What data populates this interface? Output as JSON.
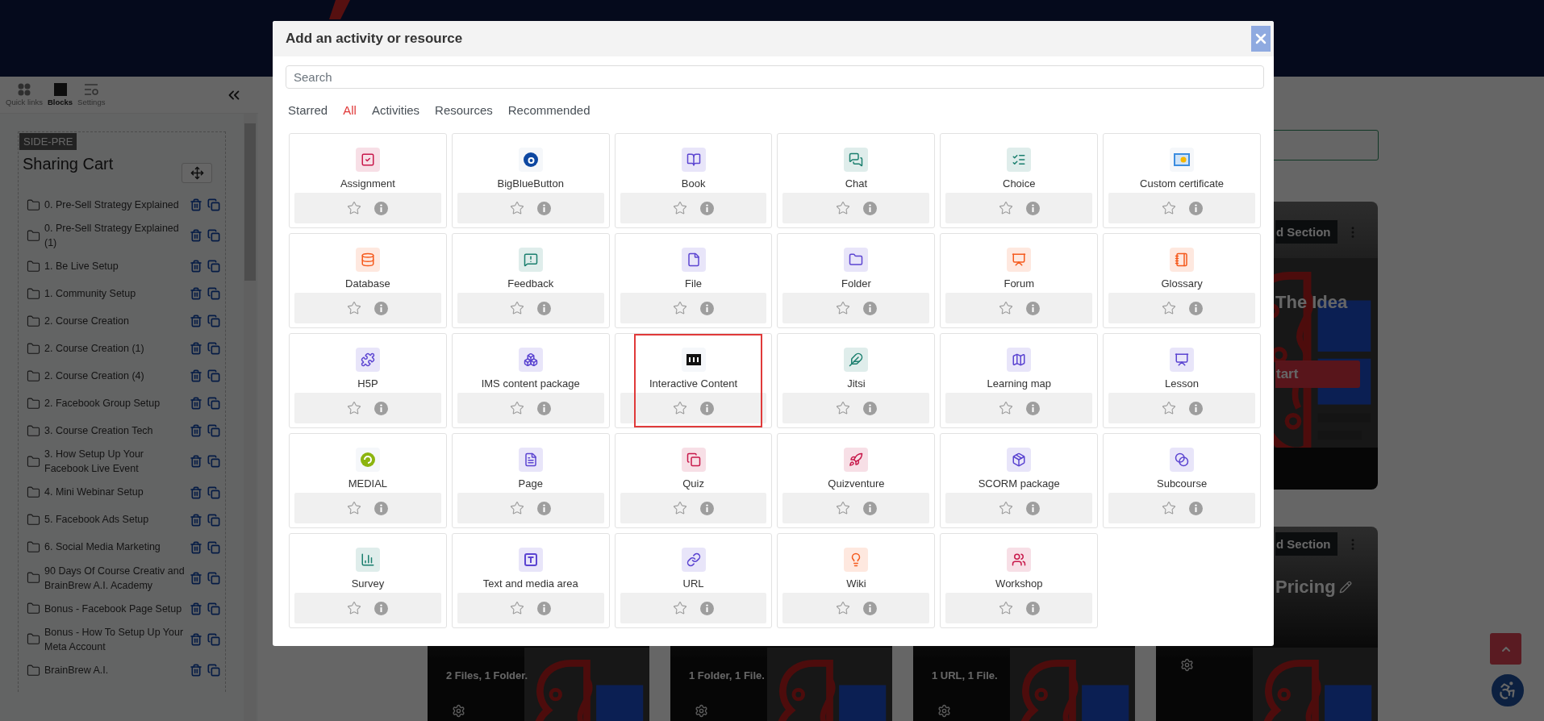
{
  "drawer": {
    "tabs": [
      {
        "label": "Quick links",
        "selected": false
      },
      {
        "label": "Blocks",
        "selected": true
      },
      {
        "label": "Settings",
        "selected": false
      }
    ],
    "block": {
      "region": "SIDE-PRE",
      "title": "Sharing Cart",
      "items": [
        {
          "label": "0. Pre-Sell Strategy Explained"
        },
        {
          "label": "0. Pre-Sell Strategy Explained (1)"
        },
        {
          "label": "1. Be Live Setup"
        },
        {
          "label": "1. Community Setup"
        },
        {
          "label": "2. Course Creation"
        },
        {
          "label": "2. Course Creation (1)"
        },
        {
          "label": "2. Course Creation (4)"
        },
        {
          "label": "2. Facebook Group Setup"
        },
        {
          "label": "3. Course Creation Tech"
        },
        {
          "label": "3. How Setup Up Your Facebook Live Event"
        },
        {
          "label": "4. Mini Webinar Setup"
        },
        {
          "label": "5. Facebook Ads Setup"
        },
        {
          "label": "6. Social Media Marketing"
        },
        {
          "label": "90 Days Of Course Creativ and BrainBrew A.I. Academy"
        },
        {
          "label": "Bonus - Facebook Page Setup"
        },
        {
          "label": "Bonus - How To Setup Up Your Meta Account"
        },
        {
          "label": "BrainBrew A.I."
        }
      ]
    }
  },
  "course": {
    "sections": [
      {
        "cards": [
          {
            "button": "d Section",
            "title": "The Idea",
            "action": "tart"
          }
        ]
      },
      {
        "cards": [
          {
            "summary": "2 Files, 1 Folder."
          },
          {
            "summary": "1 Folder, 1 File."
          },
          {
            "summary": "1 URL, 1 File."
          },
          {
            "button": "d Section",
            "title": "Pricing"
          }
        ]
      }
    ]
  },
  "modal": {
    "title": "Add an activity or resource",
    "search": {
      "placeholder": "Search"
    },
    "tabs": [
      {
        "label": "Starred",
        "selected": false
      },
      {
        "label": "All",
        "selected": true
      },
      {
        "label": "Activities",
        "selected": false
      },
      {
        "label": "Resources",
        "selected": false
      },
      {
        "label": "Recommended",
        "selected": false
      }
    ],
    "tiles": [
      {
        "label": "Assignment",
        "color": "#c8194b",
        "starred": false,
        "highlighted": false
      },
      {
        "label": "BigBlueButton",
        "color": "#0d47a1",
        "starred": false,
        "highlighted": false
      },
      {
        "label": "Book",
        "color": "#5b44d1",
        "starred": false,
        "highlighted": false
      },
      {
        "label": "Chat",
        "color": "#1a7f6e",
        "starred": false,
        "highlighted": false
      },
      {
        "label": "Choice",
        "color": "#1a7f6e",
        "starred": false,
        "highlighted": false
      },
      {
        "label": "Custom certificate",
        "color": "#3c8de0",
        "starred": false,
        "highlighted": false
      },
      {
        "label": "Database",
        "color": "#f55a1d",
        "starred": false,
        "highlighted": false
      },
      {
        "label": "Feedback",
        "color": "#1a7f6e",
        "starred": false,
        "highlighted": false
      },
      {
        "label": "File",
        "color": "#5b44d1",
        "starred": false,
        "highlighted": false
      },
      {
        "label": "Folder",
        "color": "#5b44d1",
        "starred": false,
        "highlighted": false
      },
      {
        "label": "Forum",
        "color": "#f55a1d",
        "starred": false,
        "highlighted": false
      },
      {
        "label": "Glossary",
        "color": "#f55a1d",
        "starred": false,
        "highlighted": false
      },
      {
        "label": "H5P",
        "color": "#5b44d1",
        "starred": false,
        "highlighted": false
      },
      {
        "label": "IMS content package",
        "color": "#5b44d1",
        "starred": false,
        "highlighted": false
      },
      {
        "label": "Interactive Content",
        "color": "#111111",
        "starred": false,
        "highlighted": true
      },
      {
        "label": "Jitsi",
        "color": "#1a7f6e",
        "starred": false,
        "highlighted": false
      },
      {
        "label": "Learning map",
        "color": "#5b44d1",
        "starred": false,
        "highlighted": false
      },
      {
        "label": "Lesson",
        "color": "#5b44d1",
        "starred": false,
        "highlighted": false
      },
      {
        "label": "MEDIAL",
        "color": "#8cb40f",
        "starred": false,
        "highlighted": false
      },
      {
        "label": "Page",
        "color": "#5b44d1",
        "starred": false,
        "highlighted": false
      },
      {
        "label": "Quiz",
        "color": "#c8194b",
        "starred": false,
        "highlighted": false
      },
      {
        "label": "Quizventure",
        "color": "#c8194b",
        "starred": false,
        "highlighted": false
      },
      {
        "label": "SCORM package",
        "color": "#5b44d1",
        "starred": false,
        "highlighted": false
      },
      {
        "label": "Subcourse",
        "color": "#5b44d1",
        "starred": false,
        "highlighted": false
      },
      {
        "label": "Survey",
        "color": "#1a7f6e",
        "starred": false,
        "highlighted": false
      },
      {
        "label": "Text and media area",
        "color": "#5b44d1",
        "starred": false,
        "highlighted": false
      },
      {
        "label": "URL",
        "color": "#5b44d1",
        "starred": false,
        "highlighted": false
      },
      {
        "label": "Wiki",
        "color": "#f55a1d",
        "starred": false,
        "highlighted": false
      },
      {
        "label": "Workshop",
        "color": "#c8194b",
        "starred": false,
        "highlighted": false
      }
    ]
  }
}
